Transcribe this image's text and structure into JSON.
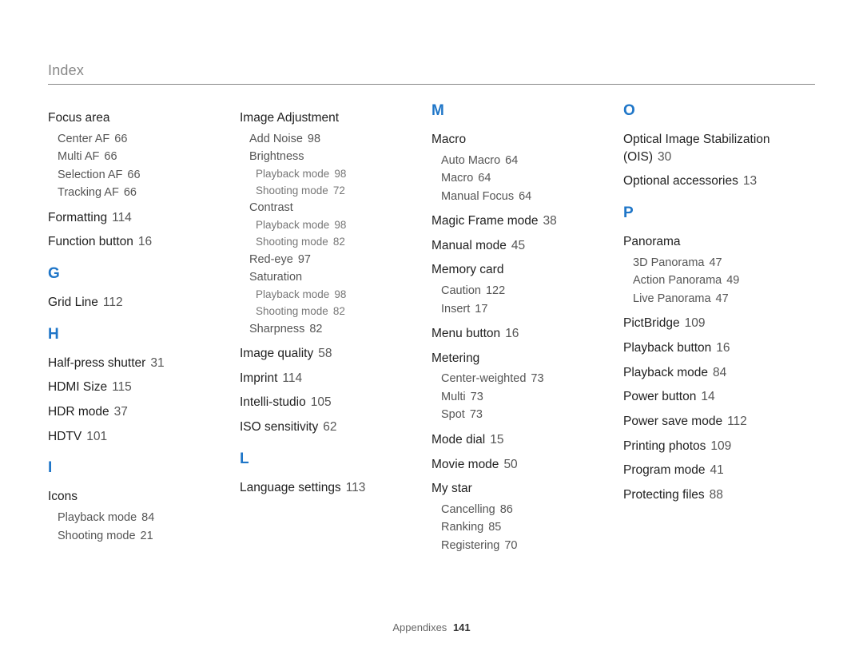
{
  "header": {
    "title": "Index"
  },
  "footer": {
    "section": "Appendixes",
    "page": "141"
  },
  "col1": {
    "focusArea": {
      "label": "Focus area"
    },
    "focusAreaSubs": [
      {
        "label": "Center AF",
        "pg": "66"
      },
      {
        "label": "Multi AF",
        "pg": "66"
      },
      {
        "label": "Selection AF",
        "pg": "66"
      },
      {
        "label": "Tracking AF",
        "pg": "66"
      }
    ],
    "formatting": {
      "label": "Formatting",
      "pg": "114"
    },
    "functionButton": {
      "label": "Function button",
      "pg": "16"
    },
    "G": "G",
    "gridLine": {
      "label": "Grid Line",
      "pg": "112"
    },
    "H": "H",
    "halfPress": {
      "label": "Half-press shutter",
      "pg": "31"
    },
    "hdmiSize": {
      "label": "HDMI Size",
      "pg": "115"
    },
    "hdrMode": {
      "label": "HDR mode",
      "pg": "37"
    },
    "hdtv": {
      "label": "HDTV",
      "pg": "101"
    },
    "I": "I",
    "icons": {
      "label": "Icons"
    },
    "iconsSubs": [
      {
        "label": "Playback mode",
        "pg": "84"
      },
      {
        "label": "Shooting mode",
        "pg": "21"
      }
    ]
  },
  "col2": {
    "imageAdj": {
      "label": "Image Adjustment"
    },
    "addNoise": {
      "label": "Add Noise",
      "pg": "98"
    },
    "brightness": {
      "label": "Brightness"
    },
    "brightnessSubs": [
      {
        "label": "Playback mode",
        "pg": "98"
      },
      {
        "label": "Shooting mode",
        "pg": "72"
      }
    ],
    "contrast": {
      "label": "Contrast"
    },
    "contrastSubs": [
      {
        "label": "Playback mode",
        "pg": "98"
      },
      {
        "label": "Shooting mode",
        "pg": "82"
      }
    ],
    "redeye": {
      "label": "Red-eye",
      "pg": "97"
    },
    "saturation": {
      "label": "Saturation"
    },
    "saturationSubs": [
      {
        "label": "Playback mode",
        "pg": "98"
      },
      {
        "label": "Shooting mode",
        "pg": "82"
      }
    ],
    "sharpness": {
      "label": "Sharpness",
      "pg": "82"
    },
    "imageQuality": {
      "label": "Image quality",
      "pg": "58"
    },
    "imprint": {
      "label": "Imprint",
      "pg": "114"
    },
    "intelli": {
      "label": "Intelli-studio",
      "pg": "105"
    },
    "iso": {
      "label": "ISO sensitivity",
      "pg": "62"
    },
    "L": "L",
    "language": {
      "label": "Language settings",
      "pg": "113"
    }
  },
  "col3": {
    "M": "M",
    "macro": {
      "label": "Macro"
    },
    "macroSubs": [
      {
        "label": "Auto Macro",
        "pg": "64"
      },
      {
        "label": "Macro",
        "pg": "64"
      },
      {
        "label": "Manual Focus",
        "pg": "64"
      }
    ],
    "magicFrame": {
      "label": "Magic Frame mode",
      "pg": "38"
    },
    "manualMode": {
      "label": "Manual mode",
      "pg": "45"
    },
    "memoryCard": {
      "label": "Memory card"
    },
    "memoryCardSubs": [
      {
        "label": "Caution",
        "pg": "122"
      },
      {
        "label": "Insert",
        "pg": "17"
      }
    ],
    "menuButton": {
      "label": "Menu button",
      "pg": "16"
    },
    "metering": {
      "label": "Metering"
    },
    "meteringSubs": [
      {
        "label": "Center-weighted",
        "pg": "73"
      },
      {
        "label": "Multi",
        "pg": "73"
      },
      {
        "label": "Spot",
        "pg": "73"
      }
    ],
    "modeDial": {
      "label": "Mode dial",
      "pg": "15"
    },
    "movieMode": {
      "label": "Movie mode",
      "pg": "50"
    },
    "myStar": {
      "label": "My star"
    },
    "myStarSubs": [
      {
        "label": "Cancelling",
        "pg": "86"
      },
      {
        "label": "Ranking",
        "pg": "85"
      },
      {
        "label": "Registering",
        "pg": "70"
      }
    ]
  },
  "col4": {
    "O": "O",
    "ois": {
      "label": "Optical Image Stabilization (OIS)",
      "pg": "30"
    },
    "optAcc": {
      "label": "Optional accessories",
      "pg": "13"
    },
    "P": "P",
    "panorama": {
      "label": "Panorama"
    },
    "panoramaSubs": [
      {
        "label": "3D Panorama",
        "pg": "47"
      },
      {
        "label": "Action Panorama",
        "pg": "49"
      },
      {
        "label": "Live Panorama",
        "pg": "47"
      }
    ],
    "pictbridge": {
      "label": "PictBridge",
      "pg": "109"
    },
    "playbackButton": {
      "label": "Playback button",
      "pg": "16"
    },
    "playbackMode": {
      "label": "Playback mode",
      "pg": "84"
    },
    "powerButton": {
      "label": "Power button",
      "pg": "14"
    },
    "powerSave": {
      "label": "Power save mode",
      "pg": "112"
    },
    "printing": {
      "label": "Printing photos",
      "pg": "109"
    },
    "programMode": {
      "label": "Program mode",
      "pg": "41"
    },
    "protecting": {
      "label": "Protecting files",
      "pg": "88"
    }
  }
}
